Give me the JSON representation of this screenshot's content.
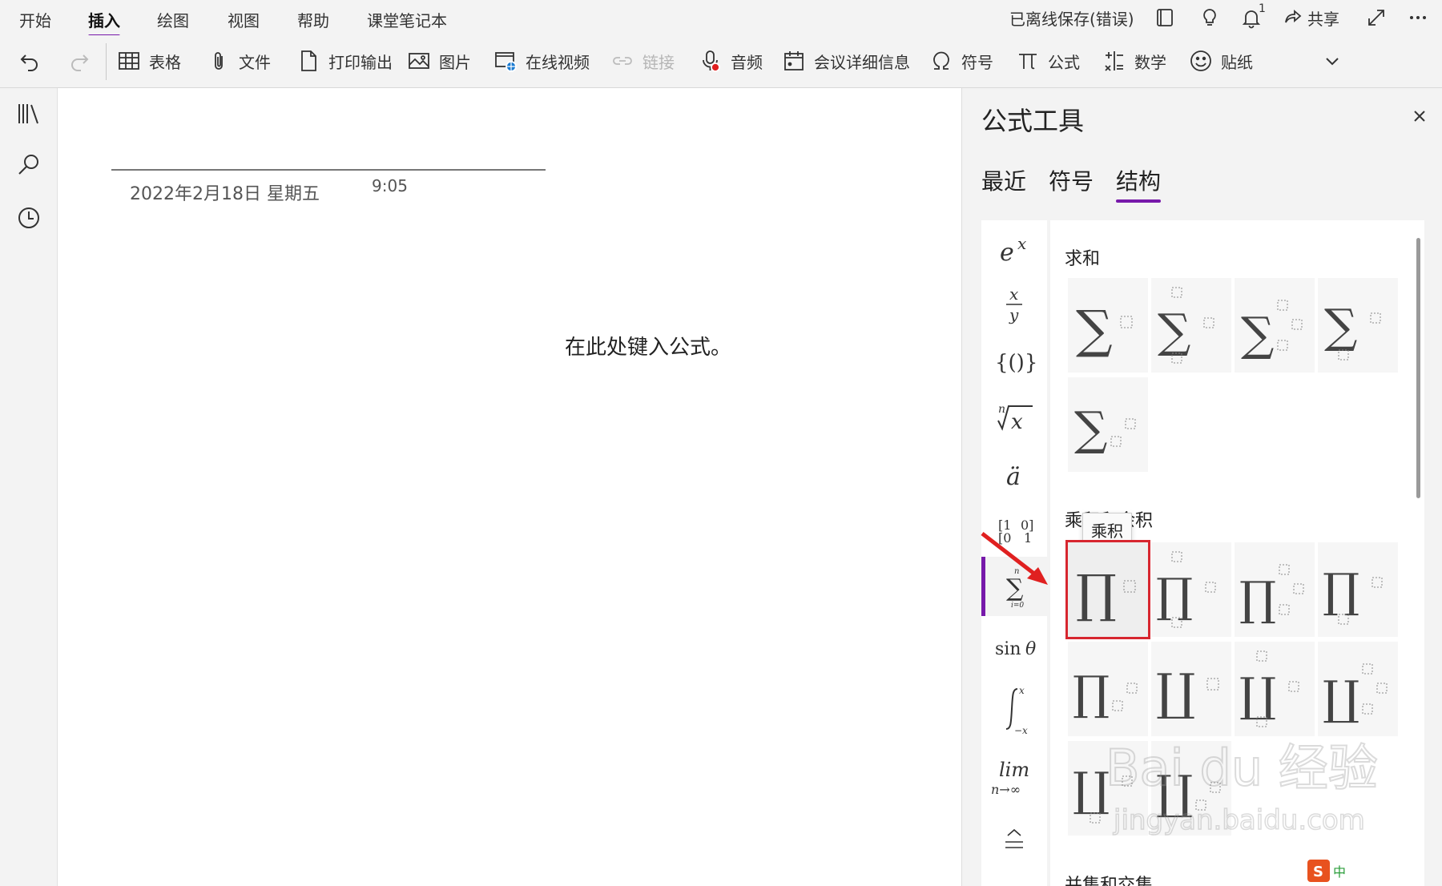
{
  "menu": {
    "tabs": [
      "开始",
      "插入",
      "绘图",
      "视图",
      "帮助",
      "课堂笔记本"
    ],
    "active_tab": "插入",
    "sync_status": "已离线保存(错误)",
    "notification_count": "1",
    "share_label": "共享"
  },
  "ribbon": {
    "table": "表格",
    "file": "文件",
    "printout": "打印输出",
    "picture": "图片",
    "online_video": "在线视频",
    "link": "链接",
    "audio": "音频",
    "meeting_details": "会议详细信息",
    "symbol": "符号",
    "equation": "公式",
    "math": "数学",
    "sticker": "贴纸"
  },
  "page": {
    "date": "2022年2月18日 星期五",
    "time": "9:05",
    "equation_placeholder": "在此处键入公式。"
  },
  "equation_pane": {
    "title": "公式工具",
    "tabs": [
      "最近",
      "符号",
      "结构"
    ],
    "active_tab": "结构",
    "sections": {
      "summation": "求和",
      "products": "乘积和余积",
      "union_intersection": "并集和交集"
    },
    "tooltip": "乘积"
  },
  "colors": {
    "accent": "#7719aa",
    "highlight": "#d7262f"
  },
  "watermark": {
    "brand": "Bai du 经验",
    "url": "jingyan.baidu.com"
  },
  "ime": {
    "label": "中"
  }
}
